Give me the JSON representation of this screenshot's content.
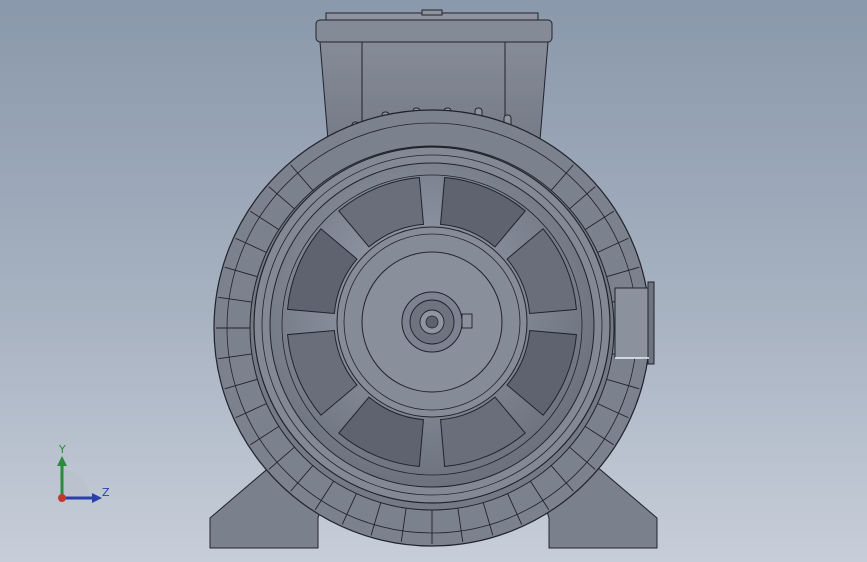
{
  "viewport": {
    "background_top": "#8a98ab",
    "background_bottom": "#c7ced9"
  },
  "model": {
    "type": "electric-motor",
    "view": "front",
    "body_color": "#7e8391",
    "edge_color": "#20232b"
  },
  "triad": {
    "y_label": "Y",
    "z_label": "Z",
    "y_color": "#2b8a3e",
    "z_color": "#2a3fa8",
    "origin_color": "#c0392b"
  }
}
